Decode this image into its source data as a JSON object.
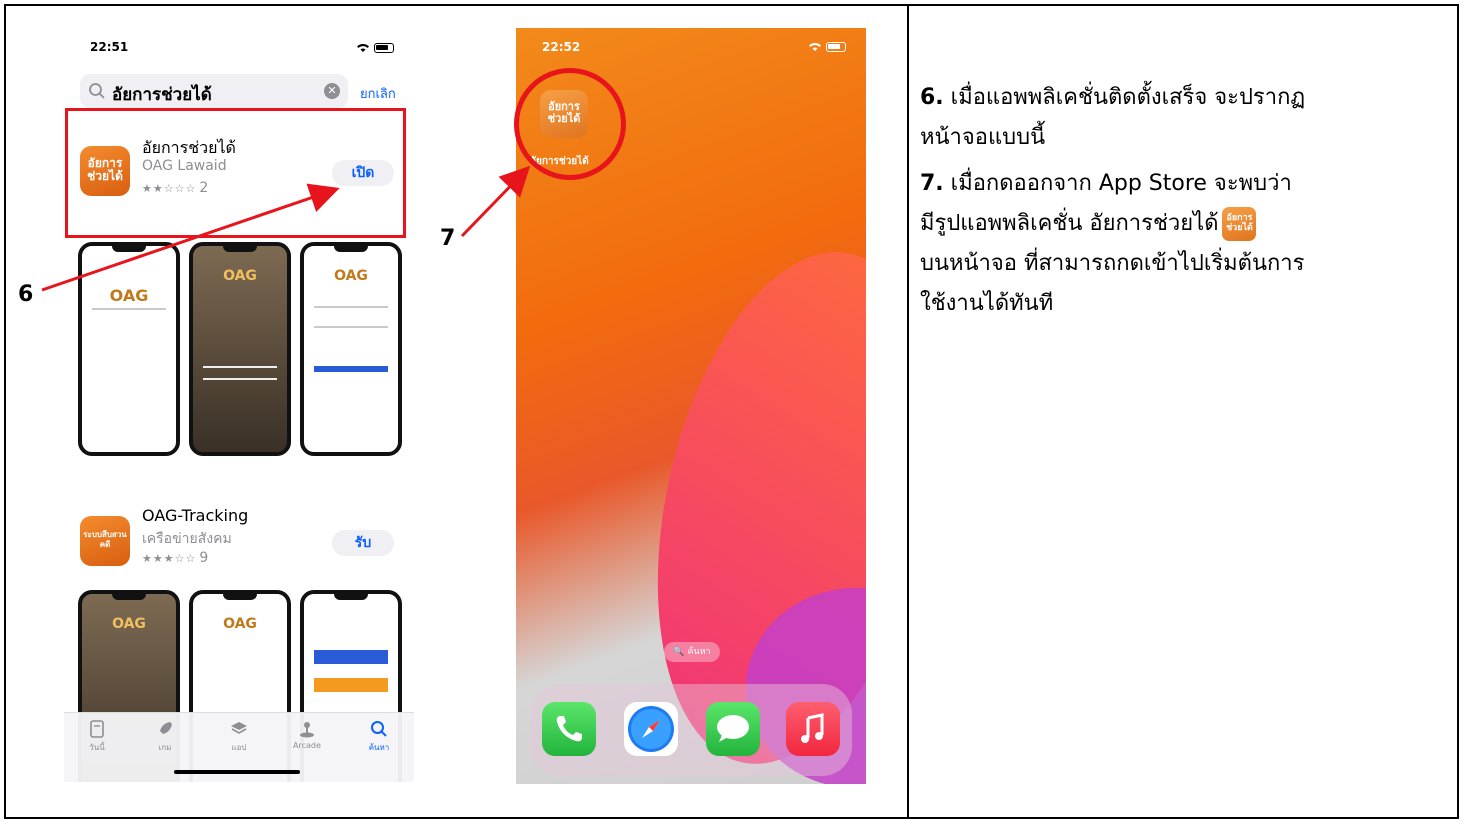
{
  "store": {
    "time": "22:51",
    "search_query": "อัยการช่วยได้",
    "cancel_label": "ยกเลิก",
    "results": [
      {
        "name": "อัยการช่วยได้",
        "subtitle": "OAG Lawaid",
        "stars": "★★☆☆☆",
        "rating_count": "2",
        "button": "เปิด",
        "icon_text": "อัยการ ช่วยได้"
      },
      {
        "name": "OAG-Tracking",
        "subtitle": "เครือข่ายสังคม",
        "stars": "★★★☆☆",
        "rating_count": "9",
        "button": "รับ",
        "icon_text": "ระบบสืบสวนคดี"
      }
    ],
    "screenshot_brand": "OAG",
    "tabs": [
      {
        "label": "วันนี้",
        "icon": "today-icon"
      },
      {
        "label": "เกม",
        "icon": "rocket-icon"
      },
      {
        "label": "แอป",
        "icon": "layers-icon"
      },
      {
        "label": "Arcade",
        "icon": "joystick-icon"
      },
      {
        "label": "ค้นหา",
        "icon": "search-icon"
      }
    ]
  },
  "home": {
    "time": "22:52",
    "app_icon_text": "อัยการ ช่วยได้",
    "app_label": "อัยการช่วยได้",
    "search_pill": "ค้นหา",
    "dock": [
      "phone-icon",
      "safari-icon",
      "messages-icon",
      "music-icon"
    ]
  },
  "annotations": {
    "step6": "6",
    "step7": "7"
  },
  "instructions": {
    "step6_num": "6.",
    "step6_text_a": "เมื่อแอพพลิเคชั่นติดตั้งเสร็จ จะปรากฏ",
    "step6_text_b": "หน้าจอแบบนี้",
    "step7_num": "7.",
    "step7_text_a": "เมื่อกดออกจาก App Store จะพบว่า",
    "step7_text_b": "มีรูปแอพพลิเคชั่น อัยการช่วยได้",
    "step7_icon_text": "อัยการ ช่วยได้",
    "step7_text_c": "บนหน้าจอ ที่สามารถกดเข้าไปเริ่มต้นการ",
    "step7_text_d": "ใช้งานได้ทันที"
  },
  "colors": {
    "highlight": "#e8141b",
    "ios_blue": "#0a60ff",
    "app_orange": "#e0741f"
  }
}
